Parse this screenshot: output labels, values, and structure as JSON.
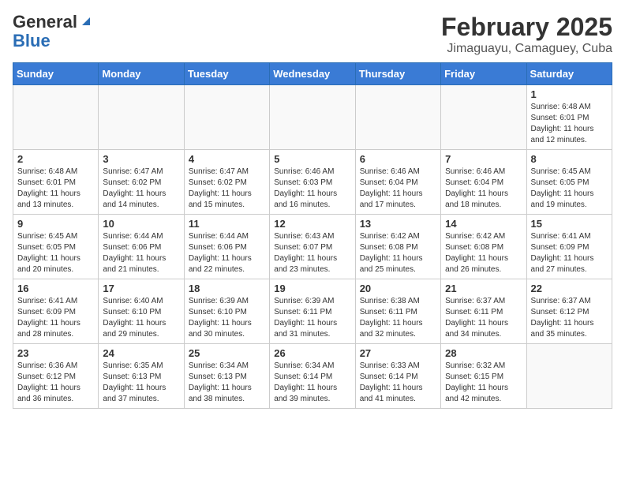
{
  "header": {
    "logo_general": "General",
    "logo_blue": "Blue",
    "title": "February 2025",
    "subtitle": "Jimaguayu, Camaguey, Cuba"
  },
  "weekdays": [
    "Sunday",
    "Monday",
    "Tuesday",
    "Wednesday",
    "Thursday",
    "Friday",
    "Saturday"
  ],
  "weeks": [
    [
      {
        "day": "",
        "info": ""
      },
      {
        "day": "",
        "info": ""
      },
      {
        "day": "",
        "info": ""
      },
      {
        "day": "",
        "info": ""
      },
      {
        "day": "",
        "info": ""
      },
      {
        "day": "",
        "info": ""
      },
      {
        "day": "1",
        "info": "Sunrise: 6:48 AM\nSunset: 6:01 PM\nDaylight: 11 hours\nand 12 minutes."
      }
    ],
    [
      {
        "day": "2",
        "info": "Sunrise: 6:48 AM\nSunset: 6:01 PM\nDaylight: 11 hours\nand 13 minutes."
      },
      {
        "day": "3",
        "info": "Sunrise: 6:47 AM\nSunset: 6:02 PM\nDaylight: 11 hours\nand 14 minutes."
      },
      {
        "day": "4",
        "info": "Sunrise: 6:47 AM\nSunset: 6:02 PM\nDaylight: 11 hours\nand 15 minutes."
      },
      {
        "day": "5",
        "info": "Sunrise: 6:46 AM\nSunset: 6:03 PM\nDaylight: 11 hours\nand 16 minutes."
      },
      {
        "day": "6",
        "info": "Sunrise: 6:46 AM\nSunset: 6:04 PM\nDaylight: 11 hours\nand 17 minutes."
      },
      {
        "day": "7",
        "info": "Sunrise: 6:46 AM\nSunset: 6:04 PM\nDaylight: 11 hours\nand 18 minutes."
      },
      {
        "day": "8",
        "info": "Sunrise: 6:45 AM\nSunset: 6:05 PM\nDaylight: 11 hours\nand 19 minutes."
      }
    ],
    [
      {
        "day": "9",
        "info": "Sunrise: 6:45 AM\nSunset: 6:05 PM\nDaylight: 11 hours\nand 20 minutes."
      },
      {
        "day": "10",
        "info": "Sunrise: 6:44 AM\nSunset: 6:06 PM\nDaylight: 11 hours\nand 21 minutes."
      },
      {
        "day": "11",
        "info": "Sunrise: 6:44 AM\nSunset: 6:06 PM\nDaylight: 11 hours\nand 22 minutes."
      },
      {
        "day": "12",
        "info": "Sunrise: 6:43 AM\nSunset: 6:07 PM\nDaylight: 11 hours\nand 23 minutes."
      },
      {
        "day": "13",
        "info": "Sunrise: 6:42 AM\nSunset: 6:08 PM\nDaylight: 11 hours\nand 25 minutes."
      },
      {
        "day": "14",
        "info": "Sunrise: 6:42 AM\nSunset: 6:08 PM\nDaylight: 11 hours\nand 26 minutes."
      },
      {
        "day": "15",
        "info": "Sunrise: 6:41 AM\nSunset: 6:09 PM\nDaylight: 11 hours\nand 27 minutes."
      }
    ],
    [
      {
        "day": "16",
        "info": "Sunrise: 6:41 AM\nSunset: 6:09 PM\nDaylight: 11 hours\nand 28 minutes."
      },
      {
        "day": "17",
        "info": "Sunrise: 6:40 AM\nSunset: 6:10 PM\nDaylight: 11 hours\nand 29 minutes."
      },
      {
        "day": "18",
        "info": "Sunrise: 6:39 AM\nSunset: 6:10 PM\nDaylight: 11 hours\nand 30 minutes."
      },
      {
        "day": "19",
        "info": "Sunrise: 6:39 AM\nSunset: 6:11 PM\nDaylight: 11 hours\nand 31 minutes."
      },
      {
        "day": "20",
        "info": "Sunrise: 6:38 AM\nSunset: 6:11 PM\nDaylight: 11 hours\nand 32 minutes."
      },
      {
        "day": "21",
        "info": "Sunrise: 6:37 AM\nSunset: 6:11 PM\nDaylight: 11 hours\nand 34 minutes."
      },
      {
        "day": "22",
        "info": "Sunrise: 6:37 AM\nSunset: 6:12 PM\nDaylight: 11 hours\nand 35 minutes."
      }
    ],
    [
      {
        "day": "23",
        "info": "Sunrise: 6:36 AM\nSunset: 6:12 PM\nDaylight: 11 hours\nand 36 minutes."
      },
      {
        "day": "24",
        "info": "Sunrise: 6:35 AM\nSunset: 6:13 PM\nDaylight: 11 hours\nand 37 minutes."
      },
      {
        "day": "25",
        "info": "Sunrise: 6:34 AM\nSunset: 6:13 PM\nDaylight: 11 hours\nand 38 minutes."
      },
      {
        "day": "26",
        "info": "Sunrise: 6:34 AM\nSunset: 6:14 PM\nDaylight: 11 hours\nand 39 minutes."
      },
      {
        "day": "27",
        "info": "Sunrise: 6:33 AM\nSunset: 6:14 PM\nDaylight: 11 hours\nand 41 minutes."
      },
      {
        "day": "28",
        "info": "Sunrise: 6:32 AM\nSunset: 6:15 PM\nDaylight: 11 hours\nand 42 minutes."
      },
      {
        "day": "",
        "info": ""
      }
    ]
  ]
}
